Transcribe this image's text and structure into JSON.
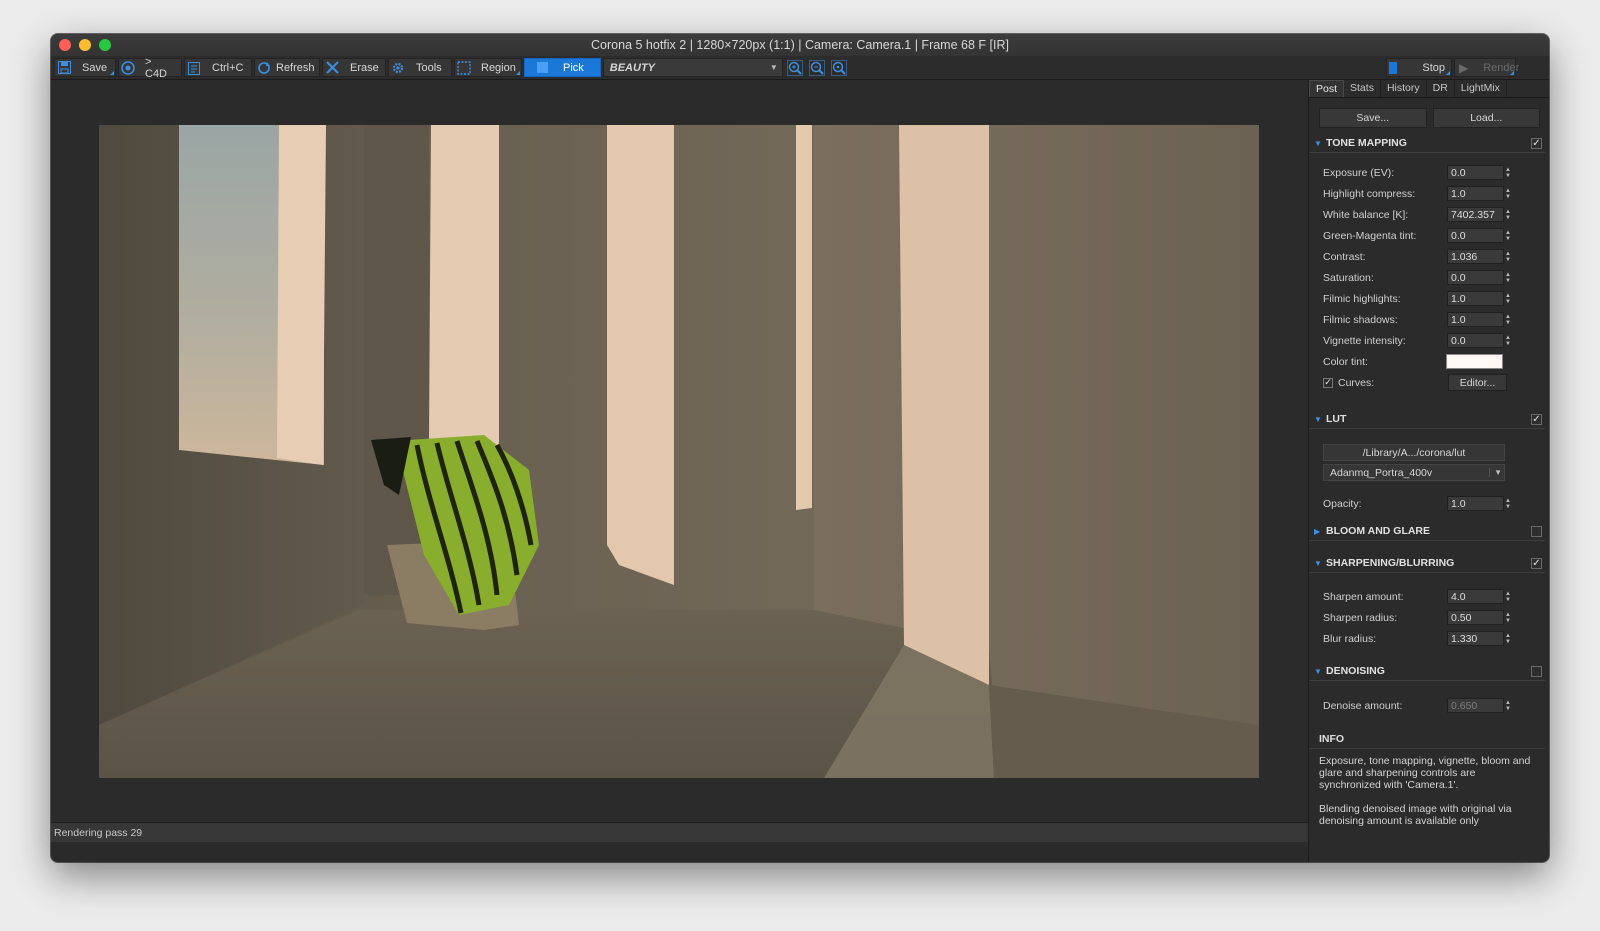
{
  "window": {
    "title": "Corona 5 hotfix 2 | 1280×720px (1:1) | Camera: Camera.1 | Frame 68 F [IR]"
  },
  "toolbar": {
    "save_label": "Save",
    "c4d_label": "> C4D",
    "copy_label": "Ctrl+C",
    "refresh_label": "Refresh",
    "erase_label": "Erase",
    "tools_label": "Tools",
    "region_label": "Region",
    "pick_label": "Pick",
    "channel_value": "BEAUTY",
    "stop_label": "Stop",
    "render_label": "Render"
  },
  "status": {
    "text": "Rendering pass 29"
  },
  "panel": {
    "tabs": [
      "Post",
      "Stats",
      "History",
      "DR",
      "LightMix"
    ],
    "active_tab": "Post",
    "save_label": "Save...",
    "load_label": "Load...",
    "tone_mapping": {
      "title": "TONE MAPPING",
      "enabled": true,
      "rows": [
        {
          "label": "Exposure (EV):",
          "value": "0.0"
        },
        {
          "label": "Highlight compress:",
          "value": "1.0"
        },
        {
          "label": "White balance [K]:",
          "value": "7402.357"
        },
        {
          "label": "Green-Magenta tint:",
          "value": "0.0"
        },
        {
          "label": "Contrast:",
          "value": "1.036"
        },
        {
          "label": "Saturation:",
          "value": "0.0"
        },
        {
          "label": "Filmic highlights:",
          "value": "1.0"
        },
        {
          "label": "Filmic shadows:",
          "value": "1.0"
        },
        {
          "label": "Vignette intensity:",
          "value": "0.0"
        }
      ],
      "color_tint_label": "Color tint:",
      "color_tint": "#fff8f4",
      "curves_label": "Curves:",
      "curves_enabled": true,
      "editor_label": "Editor..."
    },
    "lut": {
      "title": "LUT",
      "enabled": true,
      "path": "/Library/A.../corona/lut",
      "selected": "Adanmq_Portra_400v",
      "opacity_label": "Opacity:",
      "opacity": "1.0"
    },
    "bloom": {
      "title": "BLOOM AND GLARE",
      "enabled": false
    },
    "sharpening": {
      "title": "SHARPENING/BLURRING",
      "enabled": true,
      "rows": [
        {
          "label": "Sharpen amount:",
          "value": "4.0"
        },
        {
          "label": "Sharpen radius:",
          "value": "0.50"
        },
        {
          "label": "Blur radius:",
          "value": "1.330"
        }
      ]
    },
    "denoising": {
      "title": "DENOISING",
      "enabled": false,
      "amount_label": "Denoise amount:",
      "amount": "0.650"
    },
    "info": {
      "title": "INFO",
      "text1": "Exposure, tone mapping, vignette, bloom and glare and sharpening controls are synchronized with 'Camera.1'.",
      "text2": "Blending denoised image with original via denoising amount is available only"
    }
  },
  "colors": {
    "accent": "#1c78d8",
    "icon_blue": "#3d8fe3",
    "ui_bg": "#2b2b2b"
  }
}
